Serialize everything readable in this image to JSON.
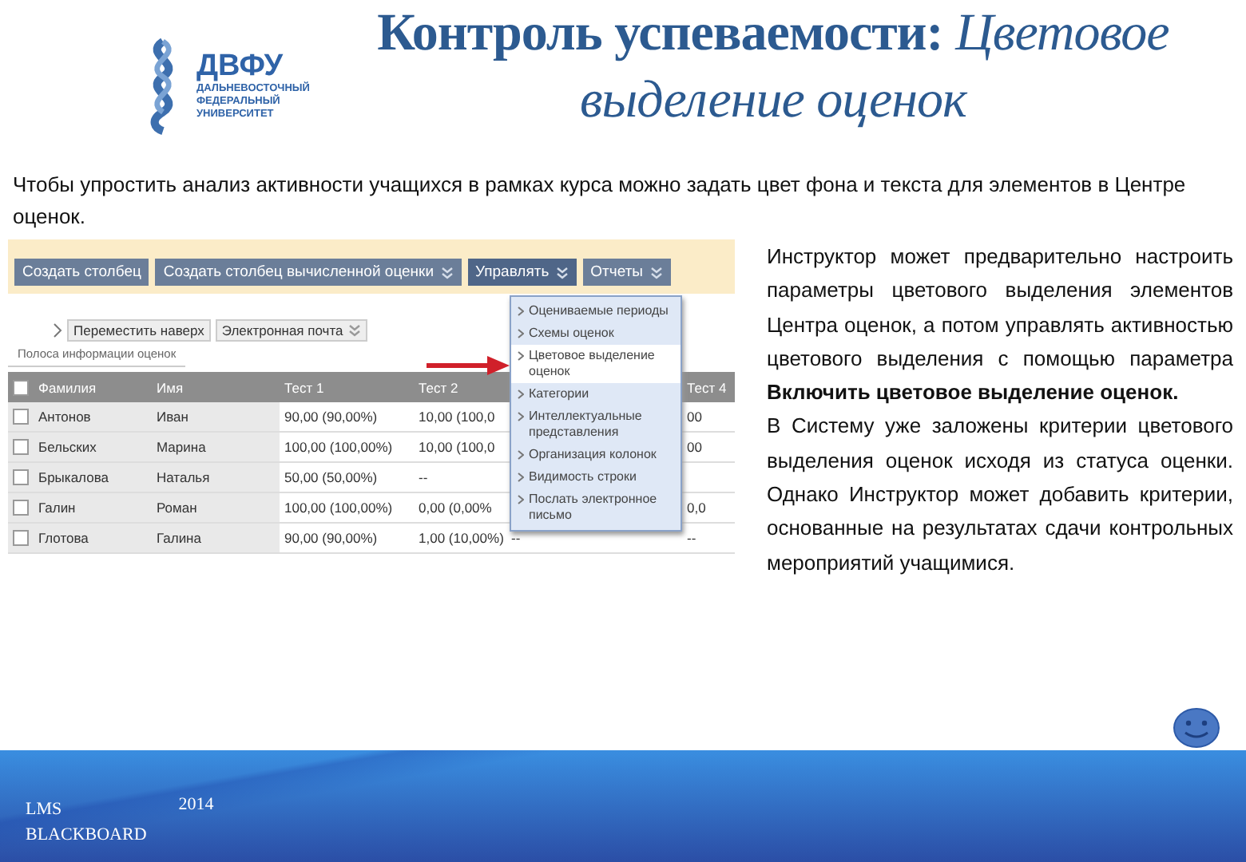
{
  "logo": {
    "acronym": "ДВФУ",
    "lines": [
      "ДАЛЬНЕВОСТОЧНЫЙ",
      "ФЕДЕРАЛЬНЫЙ",
      "УНИВЕРСИТЕТ"
    ]
  },
  "title": "**Контроль успеваемости:** *Цветовое выделение оценок*",
  "intro": "Чтобы упростить анализ активности учащихся в рамках курса можно задать цвет фона и текста для элементов в Центре оценок.",
  "screenshot": {
    "toolbar": [
      {
        "label": "Создать столбец",
        "caret": false,
        "open": false
      },
      {
        "label": "Создать столбец вычисленной оценки",
        "caret": true,
        "open": false
      },
      {
        "label": "Управлять",
        "caret": true,
        "open": true
      },
      {
        "label": "Отчеты",
        "caret": true,
        "open": false
      }
    ],
    "actions": [
      {
        "label": "Переместить наверх",
        "caret": false
      },
      {
        "label": "Электронная почта",
        "caret": true
      }
    ],
    "info_bar": "Полоса информации оценок",
    "header_checked": false,
    "columns": [
      "Фамилия",
      "Имя",
      "Тест 1",
      "Тест 2",
      "Тест 4"
    ],
    "rows": [
      {
        "checked": false,
        "cells": [
          "Антонов",
          "Иван",
          "90,00 (90,00%)",
          "10,00 (100,0",
          "00"
        ]
      },
      {
        "checked": false,
        "cells": [
          "Бельских",
          "Марина",
          "100,00 (100,00%)",
          "10,00 (100,0",
          "00"
        ]
      },
      {
        "checked": false,
        "cells": [
          "Брыкалова",
          "Наталья",
          "50,00 (50,00%)",
          "--",
          null
        ]
      },
      {
        "checked": false,
        "cells": [
          "Галин",
          "Роман",
          "100,00 (100,00%)",
          "0,00 (0,00%",
          "0,0"
        ]
      },
      {
        "checked": false,
        "cells": [
          "Глотова",
          "Галина",
          "90,00 (90,00%)",
          "1,00 (10,00%)",
          "--"
        ],
        "column_5": "--"
      }
    ],
    "menu": [
      {
        "label": "Оцениваемые периоды",
        "selected": false
      },
      {
        "label": "Схемы оценок",
        "selected": false
      },
      {
        "label": "Цветовое выделение оценок",
        "selected": true
      },
      {
        "label": "Категории",
        "selected": false
      },
      {
        "label": "Интеллектуальные представления",
        "selected": false
      },
      {
        "label": "Организация колонок",
        "selected": false
      },
      {
        "label": "Видимость строки",
        "selected": false
      },
      {
        "label": "Послать электронное письмо",
        "selected": false
      }
    ]
  },
  "side_text": [
    "Инструктор может предварительно настроить параметры цветового выделения элементов Центра оценок, а потом управлять активностью цветового выделения с помощью параметра **Включить цветовое выделение оценок.**",
    "В Систему уже заложены критерии цветового выделения оценок исходя из статуса оценки. Однако Инструктор может добавить критерии, основанные на результатах сдачи контрольных мероприятий учащимися."
  ],
  "footer": {
    "product_lines": [
      "LMS",
      "BLACKBOARD"
    ],
    "year": "2014"
  }
}
